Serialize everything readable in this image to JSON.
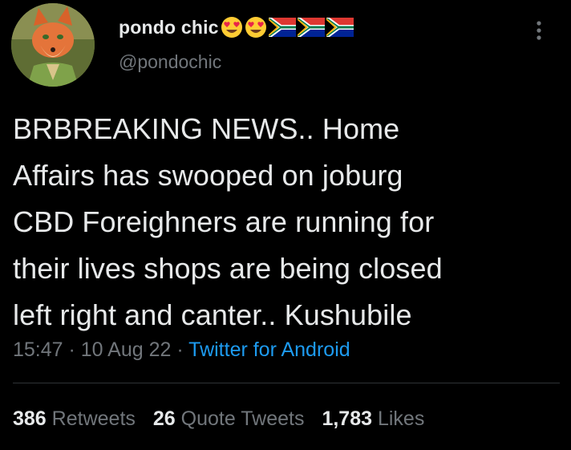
{
  "author": {
    "display_name": "pondo chic",
    "handle": "@pondochic",
    "name_emojis": [
      "heart-eyes-emoji",
      "heart-eyes-emoji",
      "south-africa-flag-emoji",
      "south-africa-flag-emoji",
      "south-africa-flag-emoji"
    ]
  },
  "tweet": {
    "text": "BRBREAKING NEWS.. Home\nAffairs has swooped on joburg\nCBD Foreighners are running for\ntheir lives shops are being closed\nleft right and canter.. Kushubile",
    "time": "15:47",
    "separator": " · ",
    "date": "10 Aug 22",
    "source": "Twitter for Android"
  },
  "stats": {
    "retweets_count": "386",
    "retweets_label": "Retweets",
    "quotes_count": "26",
    "quotes_label": "Quote Tweets",
    "likes_count": "1,783",
    "likes_label": "Likes"
  },
  "icons": {
    "more": "more-vertical-icon"
  },
  "colors": {
    "background": "#000000",
    "primary_text": "#e7e9ea",
    "secondary_text": "#71767b",
    "link": "#1d9bf0",
    "divider": "#2f3336"
  }
}
